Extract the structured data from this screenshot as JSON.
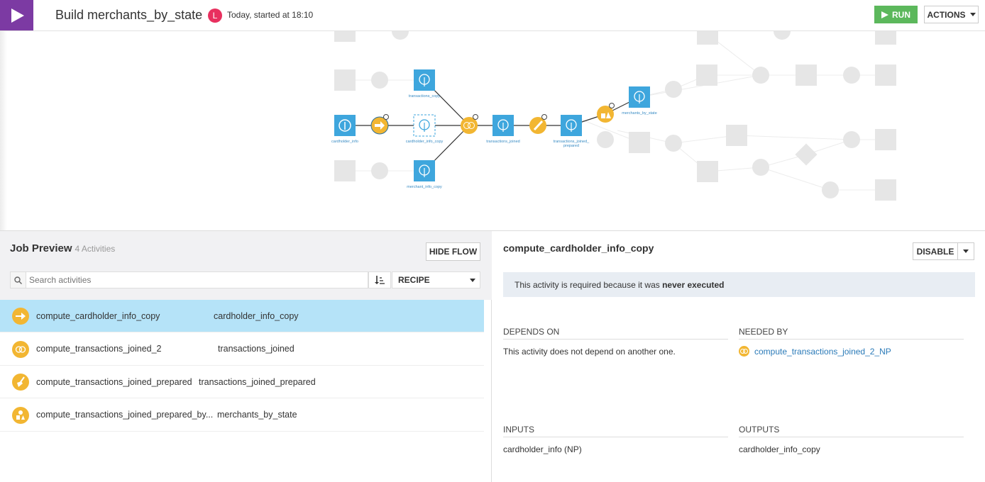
{
  "header": {
    "title": "Build merchants_by_state",
    "avatar_initial": "L",
    "started": "Today, started at 18:10",
    "run_label": "RUN",
    "actions_label": "ACTIONS"
  },
  "flow": {
    "colors": {
      "dataset": "#3ea6dd",
      "recipe": "#f2b632",
      "faded": "#e6e6e6"
    },
    "nodes": [
      {
        "id": "cardholder_info",
        "label": "cardholder_info",
        "type": "dataset"
      },
      {
        "id": "r_copy",
        "label": "",
        "type": "recipe-sync"
      },
      {
        "id": "cardholder_info_copy",
        "label": "cardholder_info_copy",
        "type": "dataset-pending"
      },
      {
        "id": "transactions_copy",
        "label": "transactions_copy",
        "type": "dataset"
      },
      {
        "id": "merchant_info_copy",
        "label": "merchant_info_copy",
        "type": "dataset"
      },
      {
        "id": "r_join",
        "label": "",
        "type": "recipe-join"
      },
      {
        "id": "transactions_joined",
        "label": "transactions_joined",
        "type": "dataset"
      },
      {
        "id": "r_prepare",
        "label": "",
        "type": "recipe-prepare"
      },
      {
        "id": "transactions_joined_prepared",
        "label": "transactions_joined_\nprepared",
        "type": "dataset"
      },
      {
        "id": "r_group",
        "label": "",
        "type": "recipe-group"
      },
      {
        "id": "merchants_by_state",
        "label": "merchants_by_state",
        "type": "dataset"
      }
    ]
  },
  "job_preview": {
    "title": "Job Preview",
    "count": "4 Activities",
    "hide_flow_label": "HIDE FLOW",
    "search_placeholder": "Search activities",
    "filter_value": "RECIPE",
    "activities": [
      {
        "name": "compute_cardholder_info_copy",
        "output": "cardholder_info_copy",
        "icon": "sync-recipe-icon",
        "selected": true
      },
      {
        "name": "compute_transactions_joined_2",
        "output": "transactions_joined",
        "icon": "join-recipe-icon",
        "selected": false
      },
      {
        "name": "compute_transactions_joined_prepared",
        "output": "transactions_joined_prepared",
        "icon": "prepare-recipe-icon",
        "selected": false
      },
      {
        "name": "compute_transactions_joined_prepared_by...",
        "output": "merchants_by_state",
        "icon": "group-recipe-icon",
        "selected": false
      }
    ]
  },
  "detail": {
    "title": "compute_cardholder_info_copy",
    "disable_label": "DISABLE",
    "notice_prefix": "This activity is required because it was ",
    "notice_bold": "never executed",
    "depends_on_label": "DEPENDS ON",
    "depends_on_text": "This activity does not depend on another one.",
    "needed_by_label": "NEEDED BY",
    "needed_by_link": "compute_transactions_joined_2_NP",
    "inputs_label": "INPUTS",
    "inputs_value": "cardholder_info (NP)",
    "outputs_label": "OUTPUTS",
    "outputs_value": "cardholder_info_copy"
  }
}
